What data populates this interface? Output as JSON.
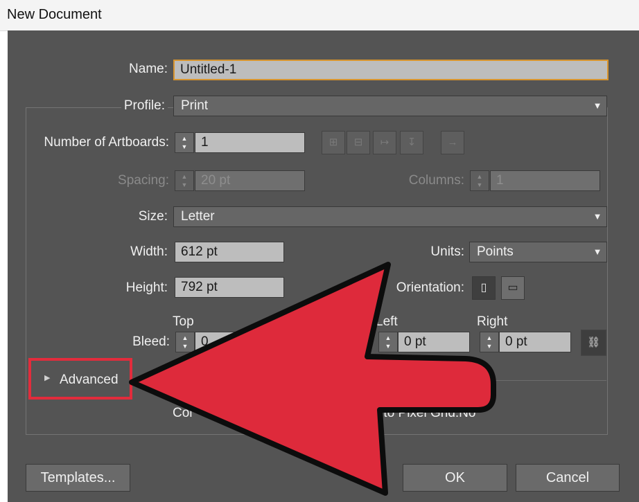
{
  "window": {
    "title": "New Document"
  },
  "form": {
    "name": {
      "label": "Name:",
      "value": "Untitled-1"
    },
    "profile": {
      "label": "Profile:",
      "value": "Print"
    },
    "artboards": {
      "label": "Number of Artboards:",
      "value": "1"
    },
    "spacing": {
      "label": "Spacing:",
      "value": "20 pt"
    },
    "columns": {
      "label": "Columns:",
      "value": "1"
    },
    "size": {
      "label": "Size:",
      "value": "Letter"
    },
    "width": {
      "label": "Width:",
      "value": "612 pt"
    },
    "units": {
      "label": "Units:",
      "value": "Points"
    },
    "height": {
      "label": "Height:",
      "value": "792 pt"
    },
    "orientation": {
      "label": "Orientation:"
    },
    "bleed": {
      "label": "Bleed:",
      "top": {
        "label": "Top",
        "value": "0"
      },
      "left": {
        "label": "Left",
        "value": "0 pt"
      },
      "right": {
        "label": "Right",
        "value": "0 pt"
      }
    },
    "advanced": {
      "label": "Advanced"
    },
    "summary": {
      "color_mode_fragment": "Col",
      "align_fragment": "gn to Pixel Grid:No"
    }
  },
  "buttons": {
    "templates": "Templates...",
    "ok": "OK",
    "cancel": "Cancel"
  },
  "colors": {
    "dialog_bg": "#545454",
    "focus_border": "#d8952f",
    "highlight": "#e22c3c"
  },
  "icons": {
    "artboard_layout": [
      "grid-by-row-icon",
      "grid-by-column-icon",
      "arrange-by-row-icon",
      "arrange-by-column-icon",
      "right-to-left-icon"
    ],
    "orientation": [
      "portrait-icon",
      "landscape-icon"
    ],
    "bleed_link": "link-chain-icon",
    "spinner": "spinner-arrows-icon",
    "advanced_toggle": "triangle-right-icon",
    "dropdown": "chevron-down-icon"
  }
}
